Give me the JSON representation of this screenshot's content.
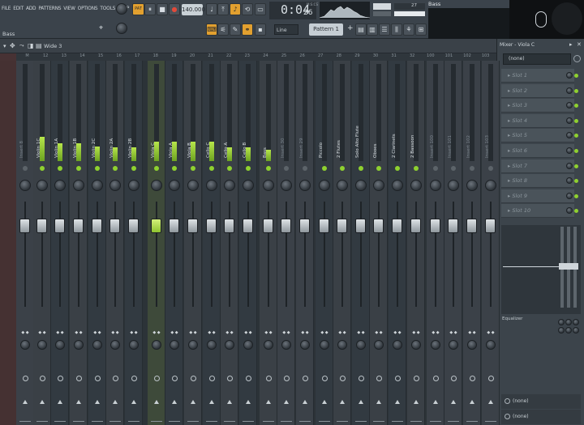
{
  "menu": [
    "FILE",
    "EDIT",
    "ADD",
    "PATTERNS",
    "VIEW",
    "OPTIONS",
    "TOOLS",
    "HELP"
  ],
  "hint": "Bass",
  "transport": {
    "pat_label": "PAT",
    "song_label": "SONG",
    "tempo": "140.000",
    "time": "0:04",
    "time_frac": "26",
    "time_unit": "M:S:CS"
  },
  "toolbar": {
    "snap": "Line",
    "pattern": "Pattern 1",
    "cpu_text": "Bass",
    "cpu_num": "27"
  },
  "mixer": {
    "preset": "Wide 3",
    "ruler": [
      "",
      "M",
      "12",
      "13",
      "14",
      "15",
      "16",
      "17",
      "18",
      "19",
      "20",
      "21",
      "22",
      "23",
      "24",
      "25",
      "26",
      "27",
      "28",
      "29",
      "30",
      "31",
      "32",
      "100",
      "101",
      "102",
      "103"
    ],
    "tracks": [
      {
        "name": "Insert 8",
        "level": 0.0,
        "dim": true
      },
      {
        "name": "Violin 1C",
        "level": 0.25,
        "dim": false
      },
      {
        "name": "Violin 1A",
        "level": 0.18,
        "dim": false
      },
      {
        "name": "Violin 1B",
        "level": 0.18,
        "dim": false
      },
      {
        "name": "Violin 2C",
        "level": 0.15,
        "dim": false
      },
      {
        "name": "Violin 2A",
        "level": 0.14,
        "dim": false
      },
      {
        "name": "Violin 2B",
        "level": 0.14,
        "dim": false
      },
      {
        "name": "Viola C",
        "level": 0.2,
        "dim": false
      },
      {
        "name": "Viola A",
        "level": 0.2,
        "dim": false
      },
      {
        "name": "Viola B",
        "level": 0.2,
        "dim": false
      },
      {
        "name": "Cello C",
        "level": 0.2,
        "dim": false
      },
      {
        "name": "Cello A",
        "level": 0.14,
        "dim": false
      },
      {
        "name": "Cello B",
        "level": 0.14,
        "dim": false
      },
      {
        "name": "Bass",
        "level": 0.12,
        "dim": false
      },
      {
        "name": "Insert 30",
        "level": 0.0,
        "dim": true
      },
      {
        "name": "Insert 29",
        "level": 0.0,
        "dim": true
      },
      {
        "name": "Piccolo",
        "level": 0.0,
        "dim": false
      },
      {
        "name": "2 Flutes",
        "level": 0.0,
        "dim": false
      },
      {
        "name": "Solo Alto Flute",
        "level": 0.0,
        "dim": false
      },
      {
        "name": "Oboes",
        "level": 0.0,
        "dim": false
      },
      {
        "name": "2 Clarinets",
        "level": 0.0,
        "dim": false
      },
      {
        "name": "2 Bassoon",
        "level": 0.0,
        "dim": false
      },
      {
        "name": "Insert 100",
        "level": 0.0,
        "dim": true
      },
      {
        "name": "Insert 101",
        "level": 0.0,
        "dim": true
      },
      {
        "name": "Insert 102",
        "level": 0.0,
        "dim": true
      },
      {
        "name": "Insert 103",
        "level": 0.0,
        "dim": true
      }
    ]
  },
  "panel": {
    "title": "Mixer - Viola C",
    "selector": "(none)",
    "slots": [
      "Slot 1",
      "Slot 2",
      "Slot 3",
      "Slot 4",
      "Slot 5",
      "Slot 6",
      "Slot 7",
      "Slot 8",
      "Slot 9",
      "Slot 10"
    ],
    "eq_label": "Equalizer",
    "out1": "(none)",
    "out2": "(none)"
  }
}
